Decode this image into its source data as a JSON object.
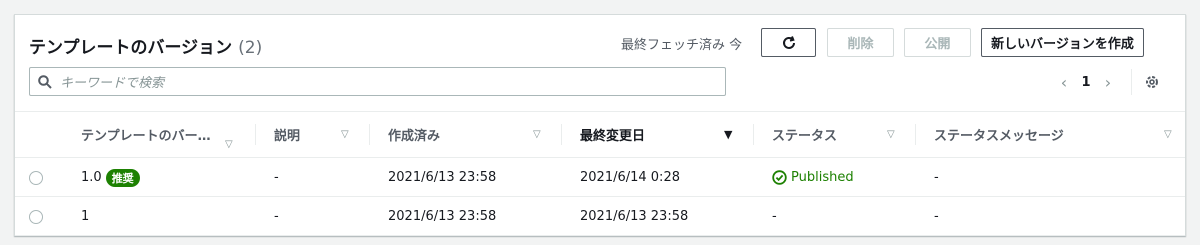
{
  "header": {
    "title": "テンプレートのバージョン",
    "count": "(2)",
    "fetch_status": "最終フェッチ済み 今",
    "delete_label": "削除",
    "publish_label": "公開",
    "create_label": "新しいバージョンを作成"
  },
  "search": {
    "placeholder": "キーワードで検索"
  },
  "pagination": {
    "current_page": "1"
  },
  "table": {
    "columns": [
      {
        "label": "テンプレートのバー…"
      },
      {
        "label": "説明"
      },
      {
        "label": "作成済み"
      },
      {
        "label": "最終変更日"
      },
      {
        "label": "ステータス"
      },
      {
        "label": "ステータスメッセージ"
      }
    ],
    "rows": [
      {
        "version": "1.0",
        "badge": "推奨",
        "description": "-",
        "created": "2021/6/13 23:58",
        "modified": "2021/6/14 0:28",
        "status": "Published",
        "message": "-"
      },
      {
        "version": "1",
        "badge": "",
        "description": "-",
        "created": "2021/6/13 23:58",
        "modified": "2021/6/13 23:58",
        "status": "-",
        "message": "-"
      }
    ]
  },
  "colors": {
    "success": "#1d8102",
    "border": "#d5dbdb",
    "text": "#16191f"
  }
}
